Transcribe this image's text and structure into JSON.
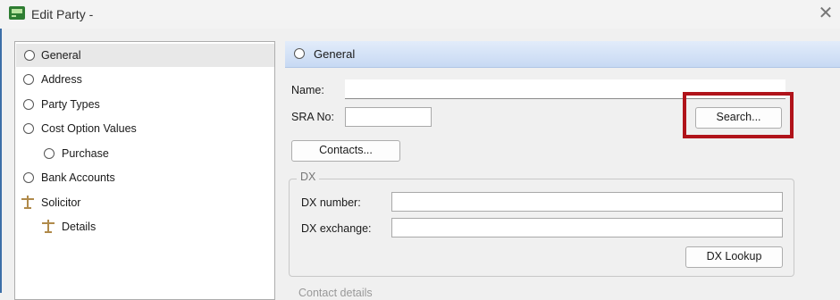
{
  "window": {
    "title": "Edit Party -",
    "close_glyph": "✕"
  },
  "nav": {
    "items": [
      {
        "label": "General"
      },
      {
        "label": "Address"
      },
      {
        "label": "Party Types"
      },
      {
        "label": "Cost Option Values"
      },
      {
        "label": "Purchase"
      },
      {
        "label": "Bank Accounts"
      },
      {
        "label": "Solicitor"
      },
      {
        "label": "Details"
      }
    ]
  },
  "section": {
    "title": "General"
  },
  "form": {
    "name_label": "Name:",
    "name_value": "",
    "sra_label": "SRA No:",
    "sra_value": "",
    "search_button": "Search...",
    "contacts_button": "Contacts..."
  },
  "dx": {
    "legend": "DX",
    "number_label": "DX number:",
    "number_value": "",
    "exchange_label": "DX exchange:",
    "exchange_value": "",
    "lookup_button": "DX Lookup"
  },
  "next_group": {
    "legend": "Contact details"
  },
  "colors": {
    "highlight": "#b0131a",
    "header_gradient": "#c7d9f3",
    "accent": "#3c6fa8"
  }
}
